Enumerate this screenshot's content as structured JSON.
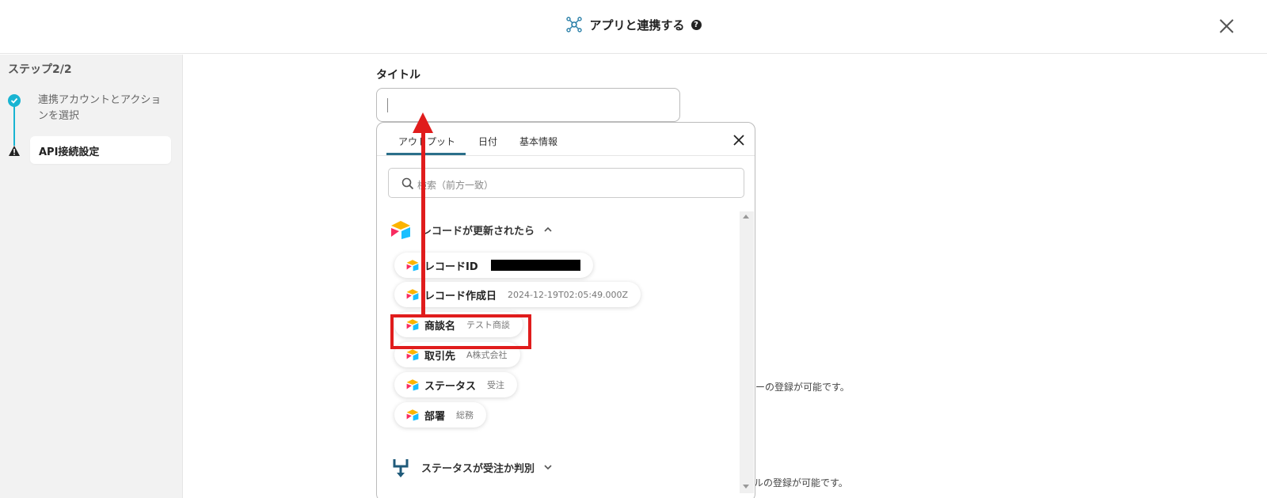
{
  "header": {
    "title": "アプリと連携する",
    "help_symbol": "?"
  },
  "sidebar": {
    "step_label": "ステップ2/2",
    "steps": [
      {
        "label": "連携アカウントとアクションを選択",
        "status": "done"
      },
      {
        "label": "API接続設定",
        "status": "warning"
      }
    ]
  },
  "form": {
    "title_label": "タイトル",
    "title_value": ""
  },
  "background_text": {
    "hint1": "バーの登録が可能です。",
    "hint2": "ルの登録が可能です。"
  },
  "panel": {
    "tabs": [
      {
        "label": "アウトプット",
        "active": true
      },
      {
        "label": "日付",
        "active": false
      },
      {
        "label": "基本情報",
        "active": false
      }
    ],
    "search_placeholder": "検索（前方一致）",
    "sections": [
      {
        "title": "レコードが更新されたら",
        "expanded": true,
        "items": [
          {
            "name": "レコードID",
            "value": ""
          },
          {
            "name": "レコード作成日",
            "value": "2024-12-19T02:05:49.000Z"
          },
          {
            "name": "商談名",
            "value": "テスト商談"
          },
          {
            "name": "取引先",
            "value": "A株式会社"
          },
          {
            "name": "ステータス",
            "value": "受注"
          },
          {
            "name": "部署",
            "value": "総務"
          }
        ]
      },
      {
        "title": "ステータスが受注か判別",
        "expanded": false,
        "items": []
      }
    ]
  },
  "colors": {
    "accent": "#19b4d2",
    "annotation": "#e01c1c",
    "tab_underline": "#2b6f8a"
  }
}
